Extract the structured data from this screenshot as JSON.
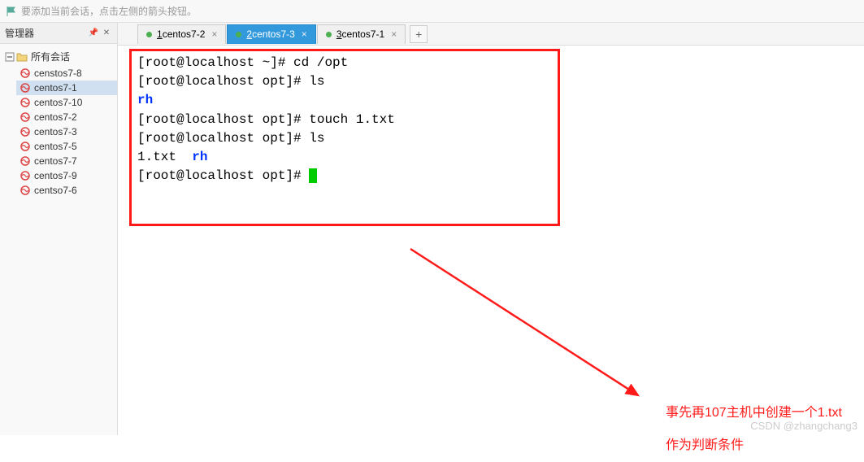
{
  "hint_text": "要添加当前会话，点击左侧的箭头按钮。",
  "sidebar": {
    "title": "管理器",
    "root_label": "所有会话",
    "items": [
      {
        "label": "censtos7-8",
        "selected": false
      },
      {
        "label": "centos7-1",
        "selected": true
      },
      {
        "label": "centos7-10",
        "selected": false
      },
      {
        "label": "centos7-2",
        "selected": false
      },
      {
        "label": "centos7-3",
        "selected": false
      },
      {
        "label": "centos7-5",
        "selected": false
      },
      {
        "label": "centos7-7",
        "selected": false
      },
      {
        "label": "centos7-9",
        "selected": false
      },
      {
        "label": "centso7-6",
        "selected": false
      }
    ]
  },
  "tabs": [
    {
      "num": "1",
      "label": "centos7-2",
      "active": false
    },
    {
      "num": "2",
      "label": "centos7-3",
      "active": true
    },
    {
      "num": "3",
      "label": "centos7-1",
      "active": false
    }
  ],
  "terminal": {
    "lines": [
      {
        "prompt": "[root@localhost ~]# ",
        "cmd": "cd /opt"
      },
      {
        "prompt": "[root@localhost opt]# ",
        "cmd": "ls"
      },
      {
        "out_blue": "rh"
      },
      {
        "prompt": "[root@localhost opt]# ",
        "cmd": "touch 1.txt"
      },
      {
        "prompt": "[root@localhost opt]# ",
        "cmd": "ls"
      },
      {
        "out_mixed_plain": "1.txt  ",
        "out_mixed_blue": "rh"
      },
      {
        "prompt": "[root@localhost opt]# ",
        "cursor": true
      }
    ]
  },
  "annotation": {
    "line1": "事先再107主机中创建一个1.txt",
    "line2": "作为判断条件"
  },
  "watermark": "CSDN @zhangchang3",
  "colors": {
    "highlight_red": "#ff1a1a",
    "tab_active": "#3399dd",
    "terminal_blue": "#0033ff",
    "cursor_green": "#00cc00"
  }
}
